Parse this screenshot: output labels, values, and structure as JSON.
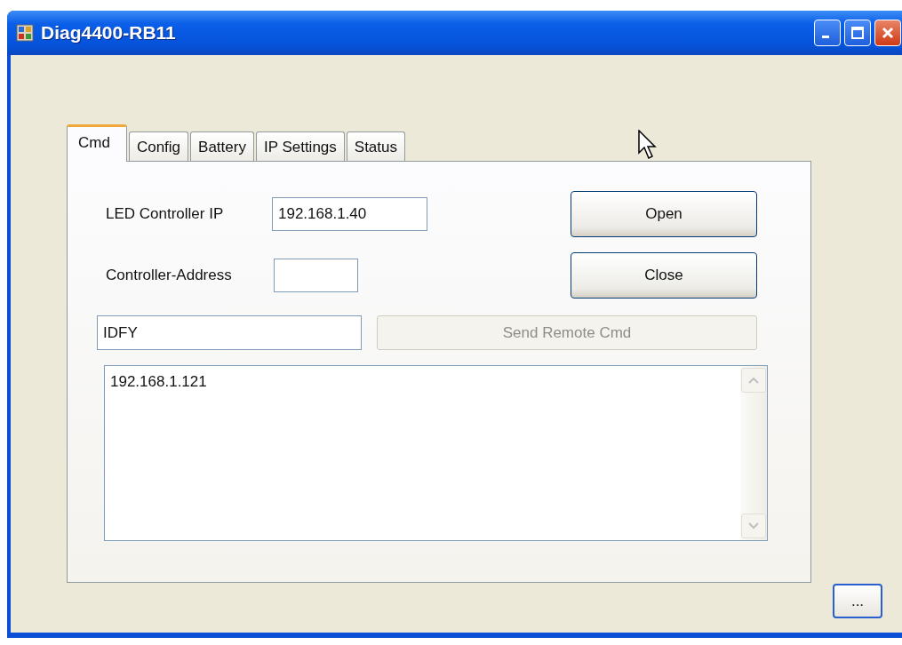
{
  "window": {
    "title": "Diag4400-RB11"
  },
  "tabs": [
    {
      "label": "Cmd",
      "selected": true
    },
    {
      "label": "Config",
      "selected": false
    },
    {
      "label": "Battery",
      "selected": false
    },
    {
      "label": "IP Settings",
      "selected": false
    },
    {
      "label": "Status",
      "selected": false
    }
  ],
  "led_controller_ip": {
    "label": "LED Controller IP",
    "value": "192.168.1.40"
  },
  "controller_address": {
    "label": "Controller-Address"
  },
  "buttons": [
    {
      "label": "Open"
    },
    {
      "label": "Close"
    }
  ],
  "command": {
    "value": "IDFY"
  },
  "send_button": {
    "label": "Send Remote Cmd",
    "disabled": true
  },
  "output": {
    "lines": [
      "192.168.1.121"
    ]
  },
  "more_button": {
    "label": "..."
  }
}
